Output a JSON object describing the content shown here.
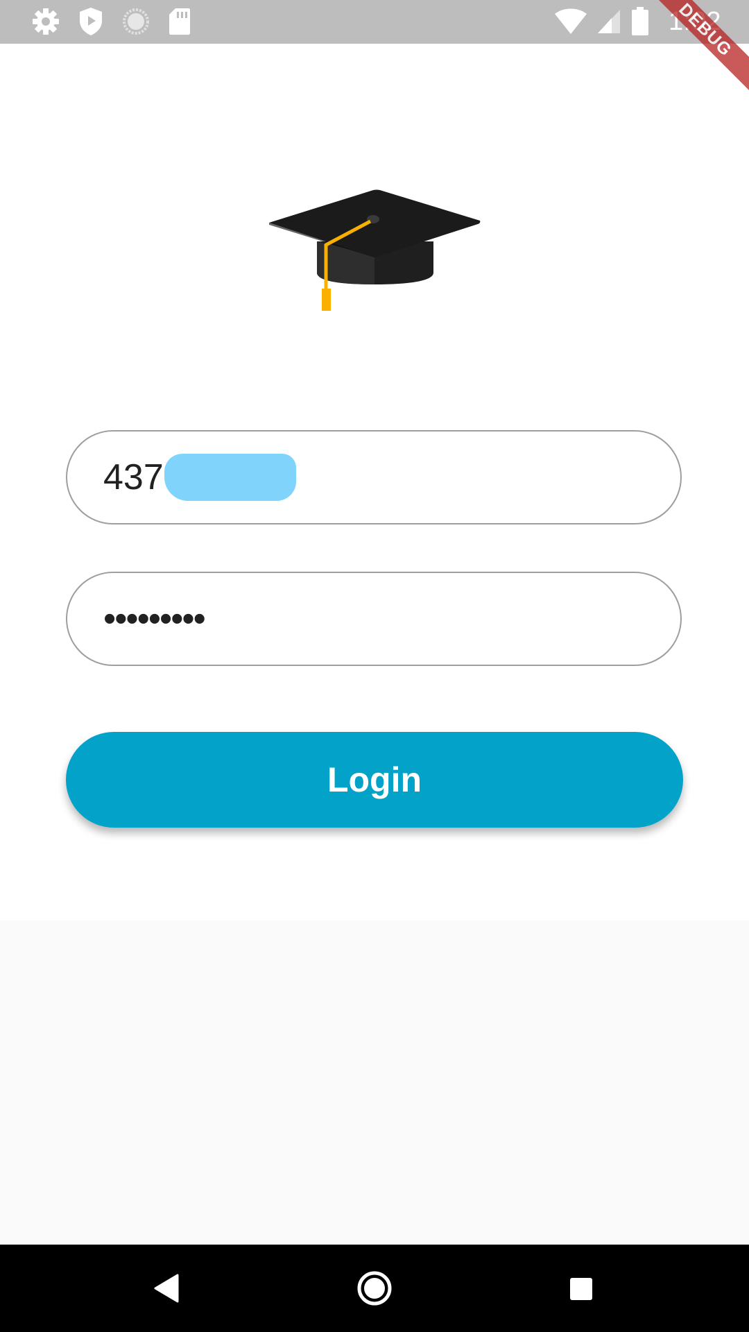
{
  "status_bar": {
    "time": "1:02",
    "left_icons": [
      "settings-icon",
      "shield-play-icon",
      "loading-circle-icon",
      "sd-card-icon"
    ],
    "right_icons": [
      "wifi-icon",
      "cell-signal-icon",
      "battery-icon"
    ]
  },
  "debug_banner": {
    "label": "DEBUG"
  },
  "login_form": {
    "logo_icon": "graduation-cap-icon",
    "id_value": "437",
    "password_value": "•••••••••",
    "login_label": "Login"
  },
  "colors": {
    "status_bar": "#bdbdbd",
    "accent": "#02a2c9",
    "field_border": "#9e9e9e",
    "tassel": "#f9b000",
    "redaction": "#80d4fc"
  },
  "nav_bar": {
    "icons": [
      "back-icon",
      "home-icon",
      "recents-icon"
    ]
  }
}
